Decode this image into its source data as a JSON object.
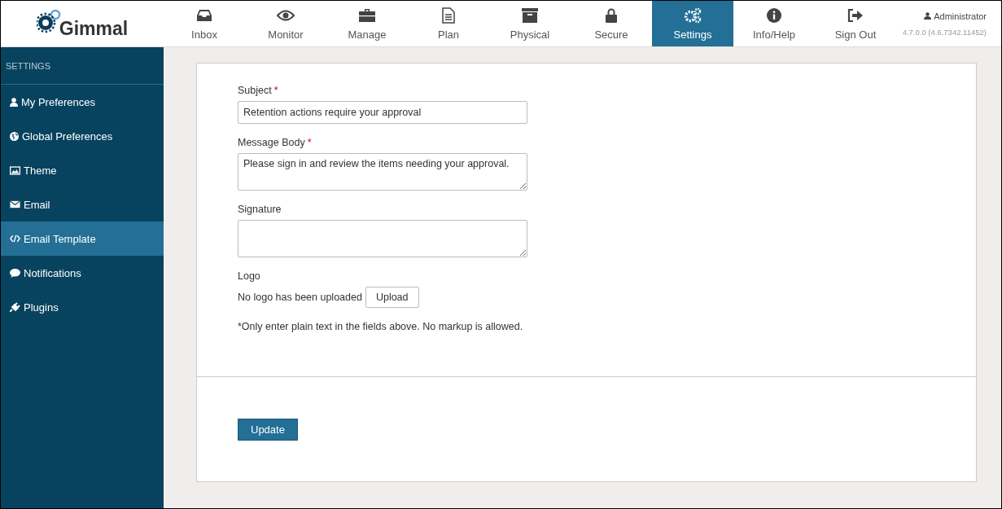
{
  "brand": {
    "name": "Gimmal"
  },
  "nav": [
    {
      "label": "Inbox",
      "selected": false
    },
    {
      "label": "Monitor",
      "selected": false
    },
    {
      "label": "Manage",
      "selected": false
    },
    {
      "label": "Plan",
      "selected": false
    },
    {
      "label": "Physical",
      "selected": false
    },
    {
      "label": "Secure",
      "selected": false
    },
    {
      "label": "Settings",
      "selected": true
    },
    {
      "label": "Info/Help",
      "selected": false
    },
    {
      "label": "Sign Out",
      "selected": false
    }
  ],
  "user": {
    "name": "Administrator",
    "version": "4.7.0.0 (4.6.7342.11452)"
  },
  "sidebar": {
    "heading": "SETTINGS",
    "items": [
      {
        "label": "My Preferences",
        "selected": false
      },
      {
        "label": "Global Preferences",
        "selected": false
      },
      {
        "label": "Theme",
        "selected": false
      },
      {
        "label": "Email",
        "selected": false
      },
      {
        "label": "Email Template",
        "selected": true
      },
      {
        "label": "Notifications",
        "selected": false
      },
      {
        "label": "Plugins",
        "selected": false
      }
    ]
  },
  "form": {
    "fields": [
      {
        "label": "Subject",
        "required_mark": "*",
        "kind": "input",
        "value": "Retention actions require your approval"
      },
      {
        "label": "Message Body",
        "required_mark": "*",
        "kind": "textarea",
        "value": "Please sign in and review the items needing your approval."
      },
      {
        "label": "Signature",
        "kind": "textarea"
      }
    ],
    "logo": {
      "label": "Logo",
      "status": "No logo has been uploaded",
      "button": "Upload"
    },
    "note": "*Only enter plain text in the fields above. No markup is allowed.",
    "submit": "Update"
  }
}
